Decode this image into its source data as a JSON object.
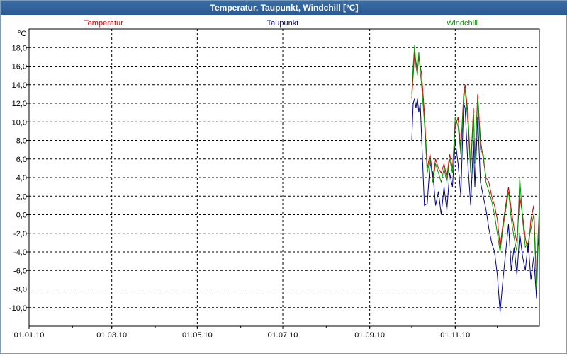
{
  "window": {
    "title": "Temperatur, Taupunkt, Windchill [°C]"
  },
  "chart_data": {
    "type": "line",
    "title": "Temperatur, Taupunkt, Windchill [°C]",
    "ylabel": "°C",
    "xlabel": "",
    "ylim": [
      -12,
      20
    ],
    "yticks": [
      18,
      16,
      14,
      12,
      10,
      8,
      6,
      4,
      2,
      0,
      -2,
      -4,
      -6,
      -8,
      -10
    ],
    "ytick_labels": [
      "18,0",
      "16,0",
      "14,0",
      "12,0",
      "10,0",
      "8,0",
      "6,0",
      "4,0",
      "2,0",
      "0,0",
      "-2,0",
      "-4,0",
      "-6,0",
      "-8,0",
      "-10,0"
    ],
    "xlim": [
      "2010-01-01",
      "2010-12-31"
    ],
    "xticks": [
      "2010-01-01",
      "2010-03-01",
      "2010-05-01",
      "2010-07-01",
      "2010-09-01",
      "2010-11-01"
    ],
    "xtick_labels": [
      "01.01.10",
      "01.03.10",
      "01.05.10",
      "01.07.10",
      "01.09.10",
      "01.11.10"
    ],
    "grid": true,
    "legend_placement": "top",
    "series": [
      {
        "name": "Temperatur",
        "color": "#cc0000",
        "points": [
          [
            "2010-10-01",
            12.5
          ],
          [
            "2010-10-02",
            15.0
          ],
          [
            "2010-10-03",
            17.5
          ],
          [
            "2010-10-04",
            16.5
          ],
          [
            "2010-10-05",
            15.5
          ],
          [
            "2010-10-06",
            17.0
          ],
          [
            "2010-10-07",
            16.0
          ],
          [
            "2010-10-08",
            15.2
          ],
          [
            "2010-10-10",
            11.0
          ],
          [
            "2010-10-12",
            5.0
          ],
          [
            "2010-10-14",
            6.5
          ],
          [
            "2010-10-16",
            4.0
          ],
          [
            "2010-10-18",
            6.0
          ],
          [
            "2010-10-20",
            5.0
          ],
          [
            "2010-10-22",
            4.5
          ],
          [
            "2010-10-24",
            5.5
          ],
          [
            "2010-10-26",
            4.0
          ],
          [
            "2010-10-28",
            6.5
          ],
          [
            "2010-10-30",
            5.0
          ],
          [
            "2010-11-01",
            9.5
          ],
          [
            "2010-11-03",
            10.5
          ],
          [
            "2010-11-05",
            7.0
          ],
          [
            "2010-11-07",
            13.0
          ],
          [
            "2010-11-08",
            14.0
          ],
          [
            "2010-11-10",
            11.0
          ],
          [
            "2010-11-12",
            5.0
          ],
          [
            "2010-11-14",
            11.5
          ],
          [
            "2010-11-15",
            6.0
          ],
          [
            "2010-11-17",
            13.0
          ],
          [
            "2010-11-19",
            8.0
          ],
          [
            "2010-11-21",
            6.0
          ],
          [
            "2010-11-23",
            4.0
          ],
          [
            "2010-11-25",
            3.5
          ],
          [
            "2010-11-27",
            2.0
          ],
          [
            "2010-11-29",
            1.0
          ],
          [
            "2010-12-01",
            -0.5
          ],
          [
            "2010-12-03",
            -3.5
          ],
          [
            "2010-12-05",
            -1.0
          ],
          [
            "2010-12-07",
            1.0
          ],
          [
            "2010-12-09",
            3.0
          ],
          [
            "2010-12-11",
            0.5
          ],
          [
            "2010-12-13",
            -1.5
          ],
          [
            "2010-12-15",
            -3.0
          ],
          [
            "2010-12-17",
            2.0
          ],
          [
            "2010-12-19",
            0.0
          ],
          [
            "2010-12-21",
            -2.5
          ],
          [
            "2010-12-23",
            -4.0
          ],
          [
            "2010-12-25",
            -0.5
          ],
          [
            "2010-12-27",
            1.0
          ],
          [
            "2010-12-29",
            -7.5
          ],
          [
            "2010-12-30",
            -3.0
          ],
          [
            "2010-12-31",
            0.0
          ]
        ]
      },
      {
        "name": "Taupunkt",
        "color": "#00008b",
        "points": [
          [
            "2010-10-01",
            8.0
          ],
          [
            "2010-10-02",
            12.0
          ],
          [
            "2010-10-03",
            12.5
          ],
          [
            "2010-10-04",
            11.5
          ],
          [
            "2010-10-05",
            12.5
          ],
          [
            "2010-10-06",
            11.0
          ],
          [
            "2010-10-07",
            12.0
          ],
          [
            "2010-10-08",
            8.5
          ],
          [
            "2010-10-10",
            1.0
          ],
          [
            "2010-10-12",
            1.2
          ],
          [
            "2010-10-14",
            5.5
          ],
          [
            "2010-10-16",
            4.5
          ],
          [
            "2010-10-18",
            1.0
          ],
          [
            "2010-10-20",
            2.5
          ],
          [
            "2010-10-22",
            0.0
          ],
          [
            "2010-10-24",
            3.0
          ],
          [
            "2010-10-26",
            0.5
          ],
          [
            "2010-10-28",
            4.5
          ],
          [
            "2010-10-30",
            3.0
          ],
          [
            "2010-11-01",
            8.0
          ],
          [
            "2010-11-03",
            5.5
          ],
          [
            "2010-11-05",
            2.0
          ],
          [
            "2010-11-07",
            12.0
          ],
          [
            "2010-11-08",
            11.5
          ],
          [
            "2010-11-10",
            5.5
          ],
          [
            "2010-11-12",
            1.0
          ],
          [
            "2010-11-14",
            8.0
          ],
          [
            "2010-11-15",
            3.0
          ],
          [
            "2010-11-17",
            10.5
          ],
          [
            "2010-11-19",
            3.5
          ],
          [
            "2010-11-21",
            2.0
          ],
          [
            "2010-11-23",
            0.5
          ],
          [
            "2010-11-25",
            -1.5
          ],
          [
            "2010-11-27",
            -3.0
          ],
          [
            "2010-11-29",
            -4.0
          ],
          [
            "2010-12-01",
            -6.5
          ],
          [
            "2010-12-03",
            -10.5
          ],
          [
            "2010-12-05",
            -7.0
          ],
          [
            "2010-12-07",
            -4.0
          ],
          [
            "2010-12-09",
            -1.0
          ],
          [
            "2010-12-11",
            -6.0
          ],
          [
            "2010-12-13",
            -3.5
          ],
          [
            "2010-12-15",
            -6.5
          ],
          [
            "2010-12-17",
            -2.0
          ],
          [
            "2010-12-19",
            -4.5
          ],
          [
            "2010-12-21",
            -6.0
          ],
          [
            "2010-12-23",
            -3.0
          ],
          [
            "2010-12-25",
            -7.0
          ],
          [
            "2010-12-27",
            -4.5
          ],
          [
            "2010-12-29",
            -9.0
          ],
          [
            "2010-12-30",
            -3.5
          ],
          [
            "2010-12-31",
            -2.0
          ]
        ]
      },
      {
        "name": "Windchill",
        "color": "#009900",
        "points": [
          [
            "2010-10-01",
            13.0
          ],
          [
            "2010-10-02",
            16.0
          ],
          [
            "2010-10-03",
            18.3
          ],
          [
            "2010-10-04",
            16.0
          ],
          [
            "2010-10-05",
            15.0
          ],
          [
            "2010-10-06",
            17.5
          ],
          [
            "2010-10-07",
            15.5
          ],
          [
            "2010-10-08",
            14.0
          ],
          [
            "2010-10-10",
            10.0
          ],
          [
            "2010-10-12",
            4.5
          ],
          [
            "2010-10-14",
            6.0
          ],
          [
            "2010-10-16",
            3.5
          ],
          [
            "2010-10-18",
            5.5
          ],
          [
            "2010-10-20",
            4.5
          ],
          [
            "2010-10-22",
            3.5
          ],
          [
            "2010-10-24",
            5.0
          ],
          [
            "2010-10-26",
            3.5
          ],
          [
            "2010-10-28",
            6.0
          ],
          [
            "2010-10-30",
            4.5
          ],
          [
            "2010-11-01",
            10.5
          ],
          [
            "2010-11-03",
            9.5
          ],
          [
            "2010-11-05",
            6.5
          ],
          [
            "2010-11-07",
            12.5
          ],
          [
            "2010-11-08",
            13.5
          ],
          [
            "2010-11-10",
            10.0
          ],
          [
            "2010-11-12",
            4.5
          ],
          [
            "2010-11-14",
            11.0
          ],
          [
            "2010-11-15",
            5.5
          ],
          [
            "2010-11-17",
            12.5
          ],
          [
            "2010-11-19",
            7.0
          ],
          [
            "2010-11-21",
            6.5
          ],
          [
            "2010-11-23",
            3.5
          ],
          [
            "2010-11-25",
            2.5
          ],
          [
            "2010-11-27",
            1.5
          ],
          [
            "2010-11-29",
            0.0
          ],
          [
            "2010-12-01",
            -2.0
          ],
          [
            "2010-12-03",
            -4.0
          ],
          [
            "2010-12-05",
            -1.5
          ],
          [
            "2010-12-07",
            0.5
          ],
          [
            "2010-12-09",
            2.5
          ],
          [
            "2010-12-11",
            -0.5
          ],
          [
            "2010-12-13",
            -2.5
          ],
          [
            "2010-12-15",
            -4.0
          ],
          [
            "2010-12-17",
            4.0
          ],
          [
            "2010-12-19",
            -0.5
          ],
          [
            "2010-12-21",
            -3.5
          ],
          [
            "2010-12-23",
            -3.0
          ],
          [
            "2010-12-25",
            -1.5
          ],
          [
            "2010-12-27",
            0.0
          ],
          [
            "2010-12-29",
            -8.0
          ],
          [
            "2010-12-30",
            -2.5
          ],
          [
            "2010-12-31",
            1.0
          ]
        ]
      }
    ]
  }
}
